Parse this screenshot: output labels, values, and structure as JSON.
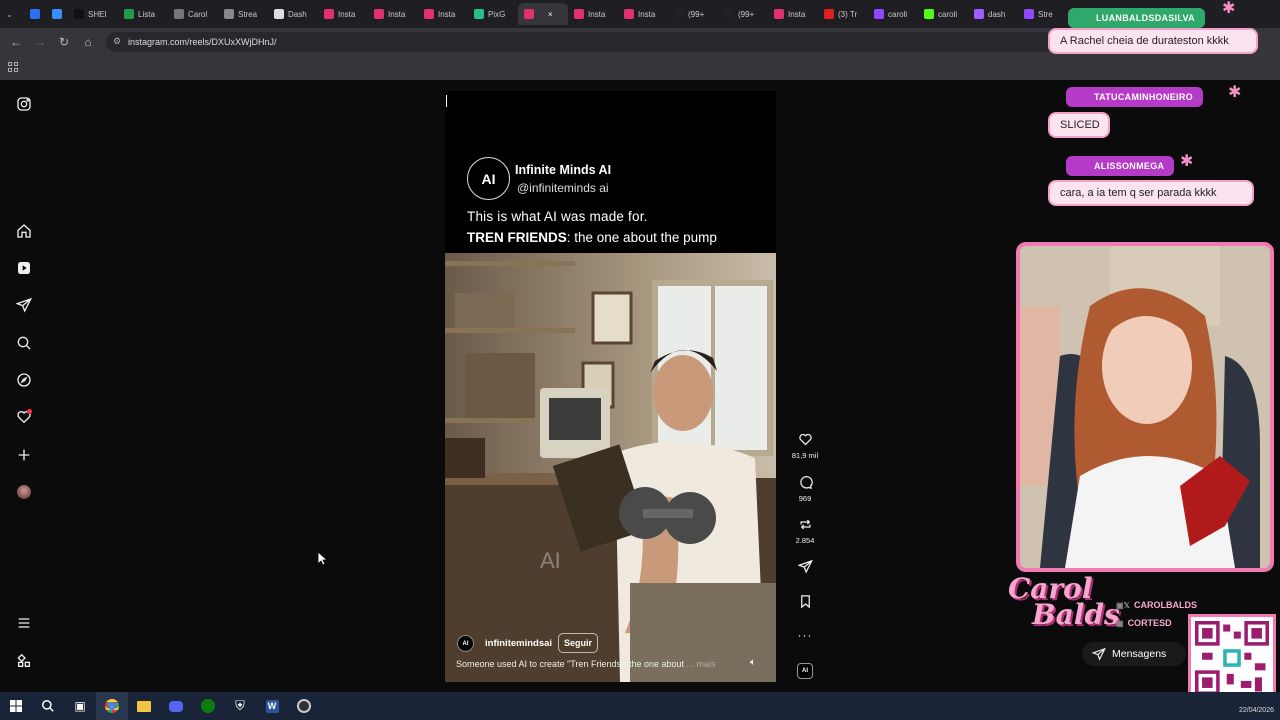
{
  "browser": {
    "tabs": [
      {
        "label": "",
        "color": "#2b6ff5"
      },
      {
        "label": "",
        "color": "#3a8dff"
      },
      {
        "label": "SHEI",
        "color": "#111111"
      },
      {
        "label": "Lista",
        "color": "#1e9e4a"
      },
      {
        "label": "Carol",
        "color": "#777777"
      },
      {
        "label": "Strea",
        "color": "#888888"
      },
      {
        "label": "Dash",
        "color": "#dddddd"
      },
      {
        "label": "Insta",
        "color": "#e1306c"
      },
      {
        "label": "Insta",
        "color": "#e1306c"
      },
      {
        "label": "Insta",
        "color": "#e1306c"
      },
      {
        "label": "PixG",
        "color": "#27c08a"
      },
      {
        "label": "",
        "color": "#e1306c"
      },
      {
        "label": "Insta",
        "color": "#e1306c"
      },
      {
        "label": "Insta",
        "color": "#e1306c"
      },
      {
        "label": "(99+",
        "color": "#222222"
      },
      {
        "label": "(99+",
        "color": "#222222"
      },
      {
        "label": "Insta",
        "color": "#e1306c"
      },
      {
        "label": "(3) Tr",
        "color": "#e02020"
      },
      {
        "label": "caroli",
        "color": "#9146ff"
      },
      {
        "label": "caroli",
        "color": "#53fc18"
      },
      {
        "label": "dash",
        "color": "#a25cff"
      },
      {
        "label": "Stre",
        "color": "#9146ff"
      }
    ],
    "url": "instagram.com/reels/DXUxXWjDHnJ/"
  },
  "sidebar": {
    "icons": [
      "instagram-logo-icon",
      "home-icon",
      "reels-icon",
      "send-icon",
      "search-icon",
      "explore-icon",
      "heart-icon",
      "plus-icon",
      "avatar",
      "menu-icon",
      "apps-icon"
    ]
  },
  "reel": {
    "account_name": "Infinite Minds AI",
    "account_handle": "@infiniteminds ai",
    "avatar_text": "AI",
    "caption_line1": "This is what AI was made for.",
    "caption_bold": "TREN FRIENDS",
    "caption_rest": ": the one about the pump",
    "footer_username": "infinitemindsai",
    "follow_label": "Seguir",
    "description": "Someone used AI to create \"Tren Friends - the one about",
    "more_label": "... mais",
    "watermark": "AI"
  },
  "actions": {
    "likes": "81,9 mil",
    "comments": "969",
    "reposts": "2.854"
  },
  "stream": {
    "chat": [
      {
        "user": "LUANBALDSDASILVA",
        "message": "A Rachel cheia de durateston kkkk"
      },
      {
        "user": "TATUCAMINHONEIRO",
        "message": "SLICED"
      },
      {
        "user": "ALISSONMEGA",
        "message": "cara, a ia tem q ser parada kkkk"
      }
    ],
    "brand_name_line1": "Carol",
    "brand_name_line2": "Balds",
    "social_x": "CAROLBALDS",
    "social_yt": "CORTESD",
    "messages_label": "Mensagens"
  },
  "taskbar": {
    "date": "22/04/2026"
  },
  "colors": {
    "chat_name_bg": "#b43ac7",
    "chat_bubble_bg": "#fbe3ef",
    "webcam_border": "#f17ab3"
  }
}
